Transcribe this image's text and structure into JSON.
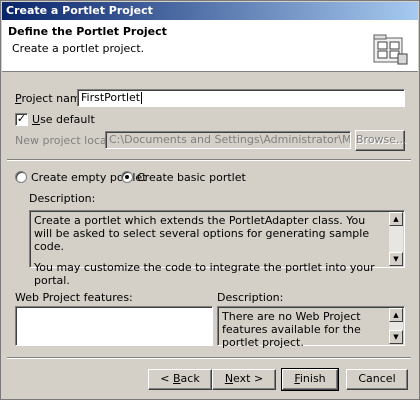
{
  "window": {
    "title": "Create a Portlet Project"
  },
  "header": {
    "title": "Define the Portlet Project",
    "subtitle": "Create a portlet project.",
    "icon": "project-folder-icon"
  },
  "project": {
    "name_label_first": "P",
    "name_label_rest": "roject name:",
    "name_value": "FirstPortlet",
    "use_default_first": "U",
    "use_default_rest": "se default",
    "use_default_checked": true,
    "location_label": "New project location:",
    "location_value": "C:\\Documents and Settings\\Administrator\\My Documents\\II",
    "browse_label": "Browse..."
  },
  "portlet_type": {
    "empty_label": "Create empty portlet",
    "basic_label": "Create basic portlet",
    "selected": "basic",
    "description_label": "Description:",
    "description_p1": "Create a portlet which extends the PortletAdapter class. You will be asked to select several options for generating sample code.",
    "description_p2": "You may customize the code to integrate the portlet into your portal."
  },
  "web_features": {
    "label": "Web Project features:",
    "items": [],
    "description_label": "Description:",
    "description": "There are no Web Project features available for the portlet project."
  },
  "buttons": {
    "back_first": "< ",
    "back_accel": "B",
    "back_rest": "ack",
    "next_accel": "N",
    "next_rest": "ext >",
    "finish_accel": "F",
    "finish_rest": "inish",
    "cancel": "Cancel"
  }
}
